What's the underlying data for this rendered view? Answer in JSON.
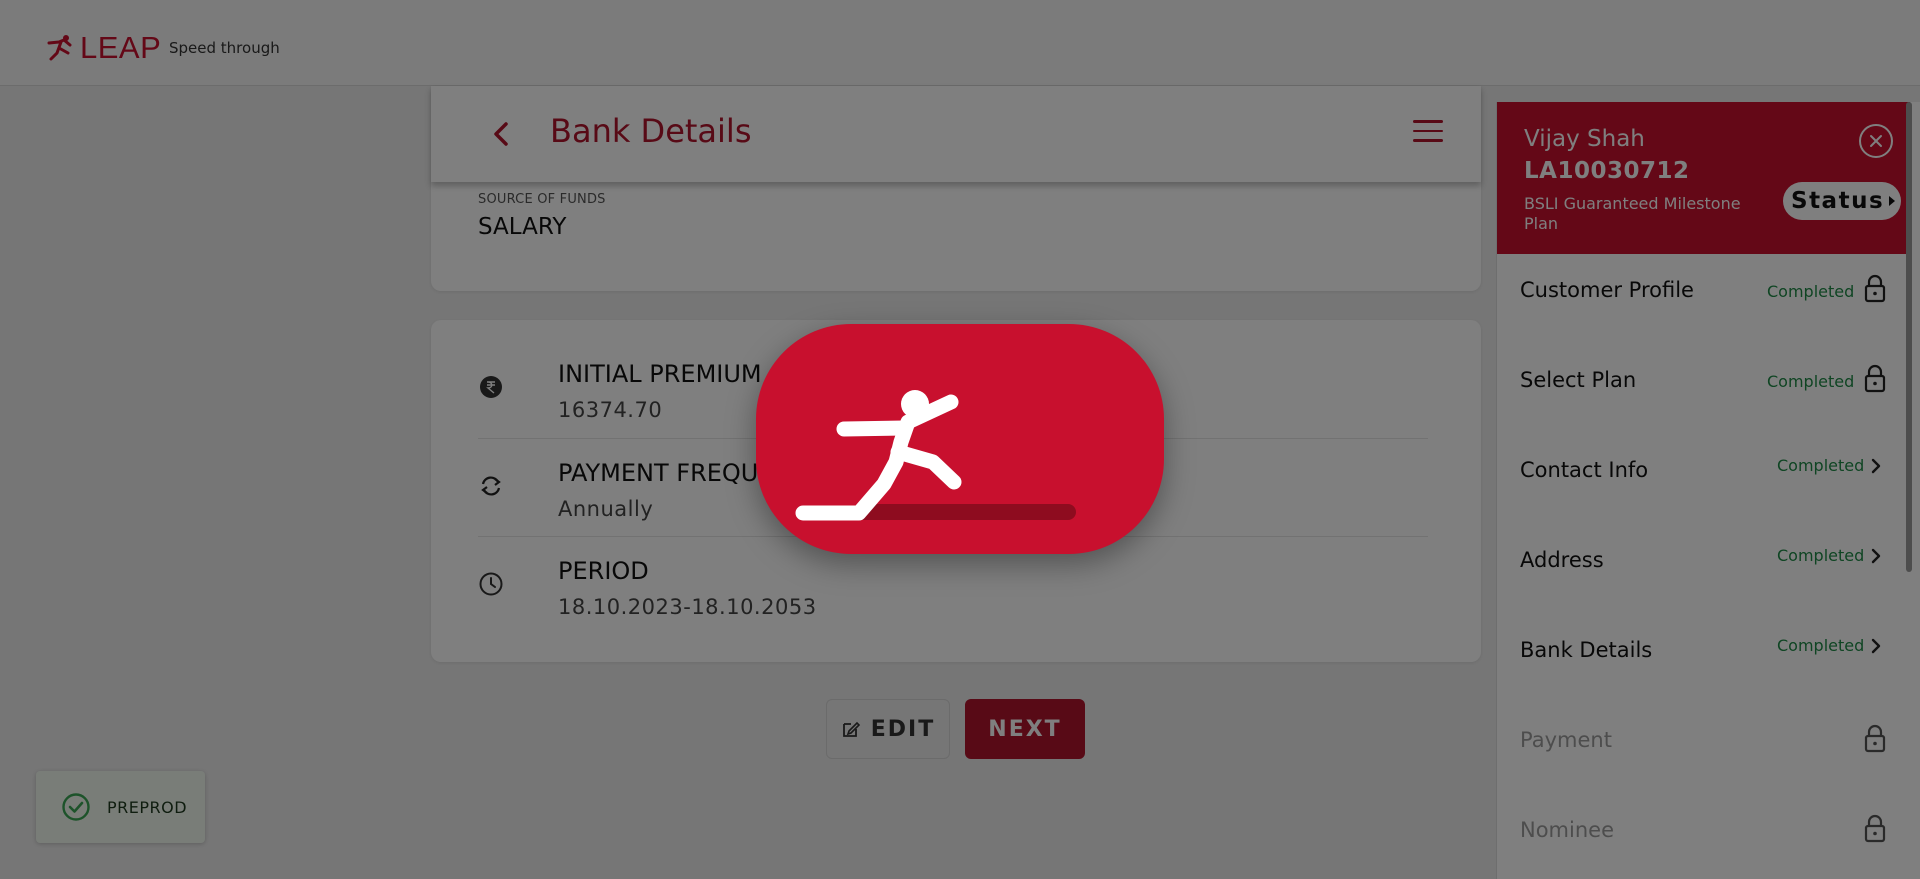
{
  "header": {
    "logo_text": "LEAP",
    "tagline": "Speed through"
  },
  "page": {
    "title": "Bank Details",
    "source_of_funds_label": "SOURCE OF FUNDS",
    "source_of_funds_value": "SALARY"
  },
  "policy": {
    "rows": [
      {
        "title": "INITIAL PREMIUM",
        "value": "16374.70",
        "icon": "rupee-icon"
      },
      {
        "title": "PAYMENT FREQUEN",
        "value": "Annually",
        "icon": "refresh-icon"
      },
      {
        "title": "PERIOD",
        "value": "18.10.2023-18.10.2053",
        "icon": "clock-icon"
      }
    ]
  },
  "actions": {
    "edit_label": "EDIT",
    "next_label": "NEXT"
  },
  "toast": {
    "text": "PREPROD"
  },
  "sidebar": {
    "customer_name": "Vijay Shah",
    "application_id": "LA10030712",
    "plan_name": "BSLI Guaranteed Milestone Plan",
    "status_label": "Status",
    "steps": [
      {
        "label": "Customer Profile",
        "status": "Completed",
        "icon": "lock-icon"
      },
      {
        "label": "Select Plan",
        "status": "Completed",
        "icon": "lock-icon"
      },
      {
        "label": "Contact Info",
        "status": "Completed",
        "icon": "chevron-right-icon"
      },
      {
        "label": "Address",
        "status": "Completed",
        "icon": "chevron-right-icon"
      },
      {
        "label": "Bank Details",
        "status": "Completed",
        "icon": "chevron-right-icon"
      },
      {
        "label": "Payment",
        "status": "",
        "icon": "lock-icon"
      },
      {
        "label": "Nominee",
        "status": "",
        "icon": "lock-icon"
      }
    ]
  },
  "colors": {
    "brand": "#c8102e",
    "completed": "#1f8a47"
  }
}
